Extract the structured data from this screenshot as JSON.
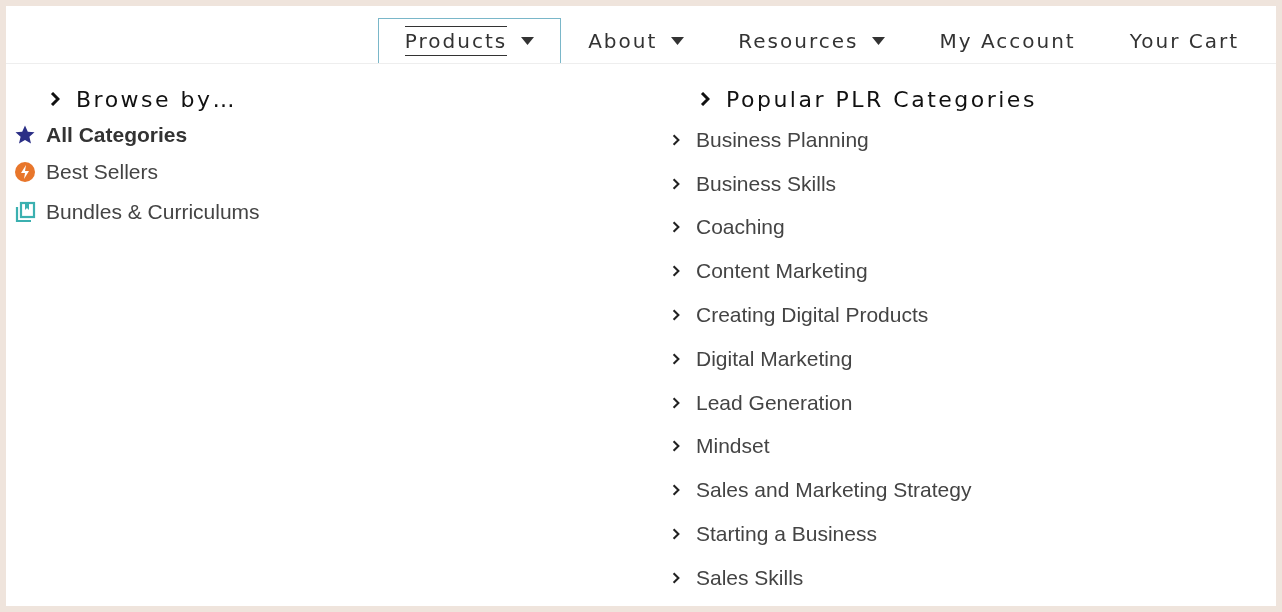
{
  "nav": [
    {
      "label": "Products",
      "dropdown": true,
      "selected": true
    },
    {
      "label": "About",
      "dropdown": true,
      "selected": false
    },
    {
      "label": "Resources",
      "dropdown": true,
      "selected": false
    },
    {
      "label": "My Account",
      "dropdown": false,
      "selected": false
    },
    {
      "label": "Your Cart",
      "dropdown": false,
      "selected": false
    }
  ],
  "browse": {
    "heading": "Browse by…",
    "items": [
      {
        "label": "All Categories",
        "kind": "star",
        "selected": true
      },
      {
        "label": "Best Sellers",
        "kind": "bolt",
        "selected": false
      },
      {
        "label": "Bundles & Curriculums",
        "kind": "bundle",
        "selected": false
      }
    ]
  },
  "categories": {
    "heading": "Popular PLR Categories",
    "items": [
      "Business Planning",
      "Business Skills",
      "Coaching",
      "Content Marketing",
      "Creating Digital Products",
      "Digital Marketing",
      "Lead Generation",
      "Mindset",
      "Sales and Marketing Strategy",
      "Starting a Business",
      "Sales Skills"
    ]
  }
}
